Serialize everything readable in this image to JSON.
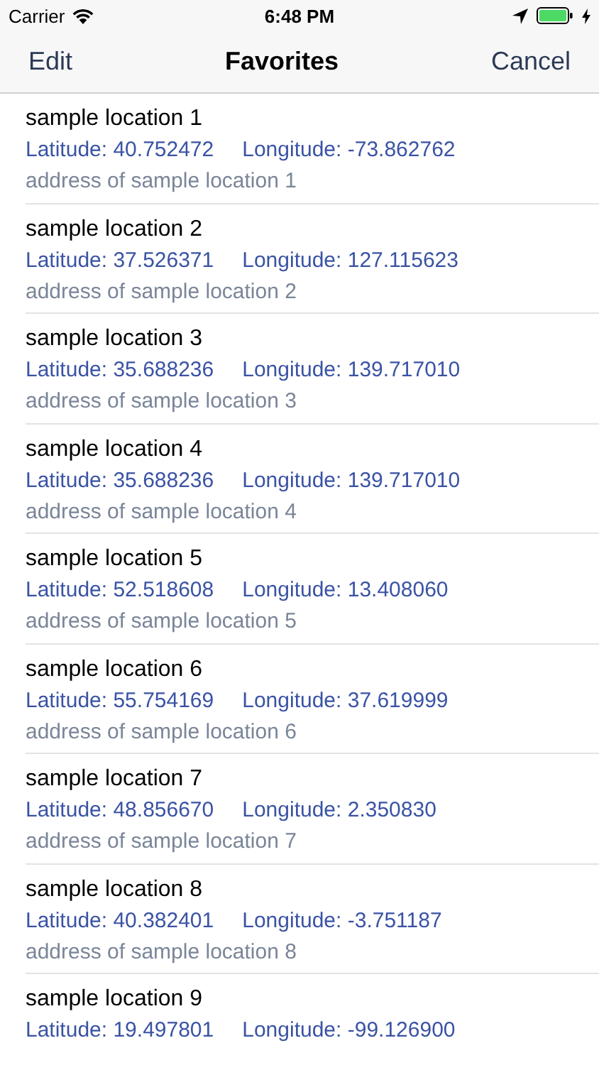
{
  "status_bar": {
    "carrier": "Carrier",
    "time": "6:48 PM"
  },
  "nav_bar": {
    "left": "Edit",
    "title": "Favorites",
    "right": "Cancel"
  },
  "locations": [
    {
      "name": "sample location 1",
      "latitude": "Latitude: 40.752472",
      "longitude": "Longitude: -73.862762",
      "address": "address of sample location 1"
    },
    {
      "name": "sample location 2",
      "latitude": "Latitude: 37.526371",
      "longitude": "Longitude: 127.115623",
      "address": "address of sample location 2"
    },
    {
      "name": "sample location 3",
      "latitude": "Latitude: 35.688236",
      "longitude": "Longitude: 139.717010",
      "address": "address of sample location 3"
    },
    {
      "name": "sample location 4",
      "latitude": "Latitude: 35.688236",
      "longitude": "Longitude: 139.717010",
      "address": "address of sample location 4"
    },
    {
      "name": "sample location 5",
      "latitude": "Latitude: 52.518608",
      "longitude": "Longitude: 13.408060",
      "address": "address of sample location 5"
    },
    {
      "name": "sample location 6",
      "latitude": "Latitude: 55.754169",
      "longitude": "Longitude: 37.619999",
      "address": "address of sample location 6"
    },
    {
      "name": "sample location 7",
      "latitude": "Latitude: 48.856670",
      "longitude": "Longitude: 2.350830",
      "address": "address of sample location 7"
    },
    {
      "name": "sample location 8",
      "latitude": "Latitude: 40.382401",
      "longitude": "Longitude: -3.751187",
      "address": "address of sample location 8"
    },
    {
      "name": "sample location 9",
      "latitude": "Latitude: 19.497801",
      "longitude": "Longitude: -99.126900"
    }
  ]
}
